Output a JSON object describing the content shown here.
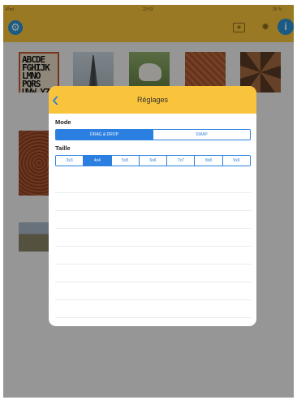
{
  "status_bar": {
    "carrier": "iPad",
    "time": "22:53",
    "battery": "35 %"
  },
  "toolbar": {
    "settings_icon": "gear-icon",
    "photo_icon": "camera-icon",
    "brightness_icon": "sun-icon",
    "info_label": "i"
  },
  "thumbnail_letters": "ABCDE FGHIJK LMNO PQRS UVW YZ",
  "modal": {
    "title": "Réglages",
    "back_icon": "chevron-left-icon",
    "mode_label": "Mode",
    "mode_options": [
      "DRAG & DROP",
      "SWAP"
    ],
    "mode_selected": "DRAG & DROP",
    "size_label": "Taille",
    "size_options": [
      "3x3",
      "4x4",
      "5x5",
      "6x6",
      "7x7",
      "8x8",
      "9x9"
    ],
    "size_selected": "4x4"
  },
  "colors": {
    "accent": "#2a7fe0",
    "bar": "#f9c33b"
  }
}
